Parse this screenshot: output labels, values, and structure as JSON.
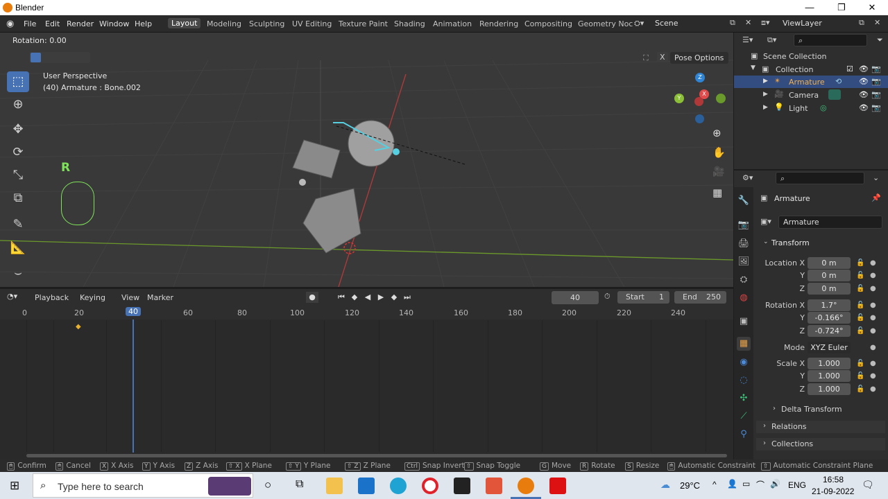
{
  "window": {
    "title": "Blender"
  },
  "menu": [
    "File",
    "Edit",
    "Render",
    "Window",
    "Help"
  ],
  "workspaces": [
    {
      "label": "Layout",
      "active": true
    },
    {
      "label": "Modeling"
    },
    {
      "label": "Sculpting"
    },
    {
      "label": "UV Editing"
    },
    {
      "label": "Texture Paint"
    },
    {
      "label": "Shading"
    },
    {
      "label": "Animation"
    },
    {
      "label": "Rendering"
    },
    {
      "label": "Compositing"
    },
    {
      "label": "Geometry Noc"
    }
  ],
  "scene": "Scene",
  "view_layer": "ViewLayer",
  "viewport": {
    "header_text": "Rotation: 0.00",
    "perspective": "User Perspective",
    "context": "(40) Armature : Bone.002",
    "key_hint": "R",
    "pose_options": "Pose Options",
    "close_x": "X"
  },
  "timeline": {
    "menus": [
      "Playback",
      "Keying",
      "View",
      "Marker"
    ],
    "current_frame": "40",
    "start_label": "Start",
    "start": "1",
    "end_label": "End",
    "end": "250",
    "ticks": [
      "0",
      "20",
      "40",
      "60",
      "80",
      "100",
      "120",
      "140",
      "160",
      "180",
      "200",
      "220",
      "240"
    ]
  },
  "outliner": {
    "scene_collection": "Scene Collection",
    "collection": "Collection",
    "items": [
      "Armature",
      "Camera",
      "Light"
    ]
  },
  "properties": {
    "object_name": "Armature",
    "data_name": "Armature",
    "transform_title": "Transform",
    "location_label": "Location X",
    "rotation_label": "Rotation X",
    "scale_label": "Scale X",
    "y": "Y",
    "z": "Z",
    "location": [
      "0 m",
      "0 m",
      "0 m"
    ],
    "rotation": [
      "1.7°",
      "-0.166°",
      "-0.724°"
    ],
    "mode_label": "Mode",
    "mode": "XYZ Euler",
    "scale": [
      "1.000",
      "1.000",
      "1.000"
    ],
    "delta_transform": "Delta Transform",
    "relations": "Relations",
    "collections": "Collections"
  },
  "statusbar": [
    {
      "label": "Confirm"
    },
    {
      "label": "Cancel"
    },
    {
      "key": "X",
      "label": "X Axis"
    },
    {
      "key": "Y",
      "label": "Y Axis"
    },
    {
      "key": "Z",
      "label": "Z Axis"
    },
    {
      "key": "⇧ X",
      "label": "X Plane"
    },
    {
      "key": "⇧ Y",
      "label": "Y Plane"
    },
    {
      "key": "⇧ Z",
      "label": "Z Plane"
    },
    {
      "key": "Ctrl",
      "label": "Snap Invert"
    },
    {
      "key": "⇧",
      "label": "Snap Toggle"
    },
    {
      "key": "G",
      "label": "Move"
    },
    {
      "key": "R",
      "label": "Rotate"
    },
    {
      "key": "S",
      "label": "Resize"
    },
    {
      "label": "Automatic Constraint"
    },
    {
      "label": "Automatic Constraint Plane"
    }
  ],
  "taskbar": {
    "search_placeholder": "Type here to search",
    "weather": "29°C",
    "lang": "ENG",
    "time": "16:58",
    "date": "21-09-2022"
  },
  "colors": {
    "accent": "#4772b3",
    "grid_x": "#e24b4b",
    "grid_y": "#8bbf37",
    "keyframe": "#e7b030"
  }
}
